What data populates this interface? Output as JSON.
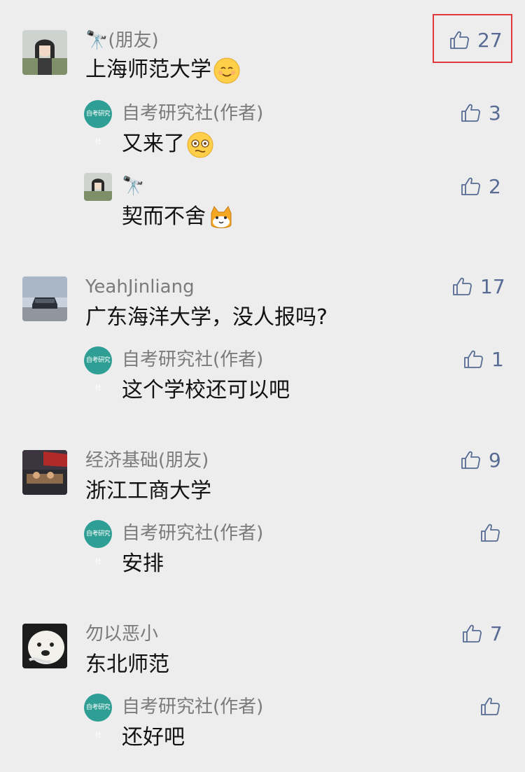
{
  "comments": [
    {
      "name": "🔭(朋友)",
      "text": "上海师范大学",
      "likes": "27",
      "replies": [
        {
          "name": "自考研究社(作者)",
          "text": "又来了",
          "likes": "3"
        },
        {
          "name": "🔭",
          "text": "契而不舍",
          "likes": "2"
        }
      ]
    },
    {
      "name": "YeahJinliang",
      "text": "广东海洋大学，没人报吗?",
      "likes": "17",
      "replies": [
        {
          "name": "自考研究社(作者)",
          "text": "这个学校还可以吧",
          "likes": "1"
        }
      ]
    },
    {
      "name": "经济基础(朋友)",
      "text": "浙江工商大学",
      "likes": "9",
      "replies": [
        {
          "name": "自考研究社(作者)",
          "text": "安排",
          "likes": ""
        }
      ]
    },
    {
      "name": "勿以恶小",
      "text": "东北师范",
      "likes": "7",
      "replies": [
        {
          "name": "自考研究社(作者)",
          "text": "还好吧",
          "likes": ""
        }
      ]
    }
  ],
  "author_avatar_text": "自考研究社",
  "colors": {
    "background": "#ededed",
    "link_blue": "#576b95",
    "highlight_red": "#e0393e",
    "author_teal": "#2f9f95"
  }
}
